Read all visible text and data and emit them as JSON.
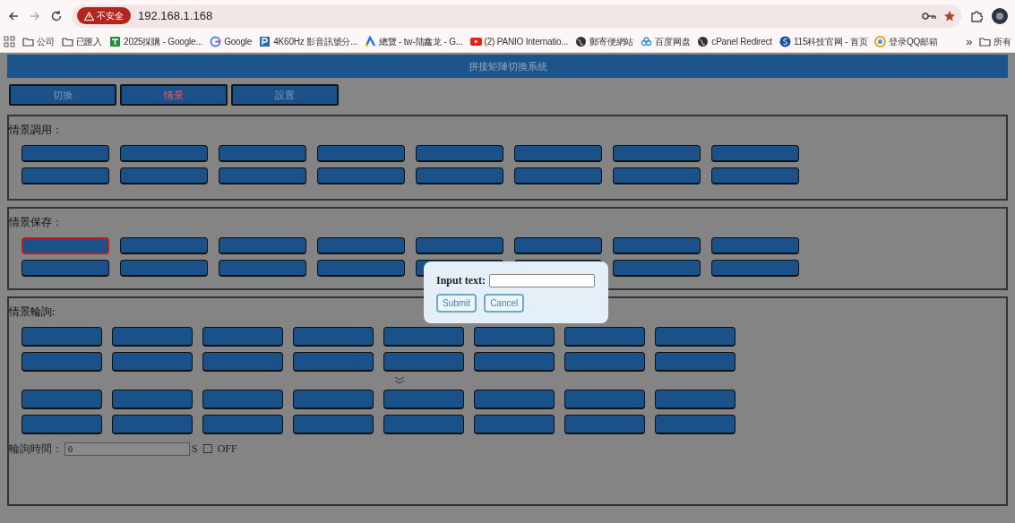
{
  "browser": {
    "security_label": "不安全",
    "url": "192.168.1.168",
    "bookmarks": [
      {
        "kind": "apps"
      },
      {
        "kind": "folder",
        "label": "公司"
      },
      {
        "kind": "folder",
        "label": "已匯入"
      },
      {
        "kind": "sheet",
        "label": "2025採購 - Google..."
      },
      {
        "kind": "google",
        "label": "Google"
      },
      {
        "kind": "p",
        "label": "4K60Hz 影音訊號分..."
      },
      {
        "kind": "ads",
        "label": "總覽 - tw-陆鑫龙 - G..."
      },
      {
        "kind": "video",
        "label": "(2) PANIO Internatio..."
      },
      {
        "kind": "globe",
        "label": "郵寄便網站"
      },
      {
        "kind": "cloud",
        "label": "百度网盘"
      },
      {
        "kind": "globe",
        "label": "cPanel Redirect"
      },
      {
        "kind": "s",
        "label": "115科技官网 - 首页"
      },
      {
        "kind": "qq",
        "label": "登录QQ邮箱"
      }
    ],
    "more": "»",
    "folder_label": "所有"
  },
  "page": {
    "title": "拼接矩陣切換系統",
    "tabs": [
      {
        "label": "切換",
        "selected": false
      },
      {
        "label": "情景",
        "selected": true
      },
      {
        "label": "設置",
        "selected": false
      }
    ],
    "sections": [
      {
        "label": "情景調用：",
        "groups": [
          {
            "rows": [
              [
                {
                  "selected": false
                },
                {
                  "selected": false
                },
                {
                  "selected": false
                },
                {
                  "selected": false
                },
                {
                  "selected": false
                },
                {
                  "selected": false
                },
                {
                  "selected": false
                },
                {
                  "selected": false
                }
              ],
              [
                {
                  "selected": false
                },
                {
                  "selected": false
                },
                {
                  "selected": false
                },
                {
                  "selected": false
                },
                {
                  "selected": false
                },
                {
                  "selected": false
                },
                {
                  "selected": false
                },
                {
                  "selected": false
                }
              ]
            ]
          }
        ]
      },
      {
        "label": "情景保存：",
        "groups": [
          {
            "rows": [
              [
                {
                  "selected": true
                },
                {
                  "selected": false
                },
                {
                  "selected": false
                },
                {
                  "selected": false
                },
                {
                  "selected": false
                },
                {
                  "selected": false
                },
                {
                  "selected": false
                },
                {
                  "selected": false
                }
              ],
              [
                {
                  "selected": false
                },
                {
                  "selected": false
                },
                {
                  "selected": false
                },
                {
                  "selected": false
                },
                {
                  "selected": false
                },
                {
                  "selected": false
                },
                {
                  "selected": false
                },
                {
                  "selected": false
                }
              ]
            ]
          }
        ]
      },
      {
        "label": "情景輪詢:",
        "groups": [
          {
            "rows": [
              [
                {
                  "selected": false
                },
                {
                  "selected": false
                },
                {
                  "selected": false
                },
                {
                  "selected": false
                },
                {
                  "selected": false
                },
                {
                  "selected": false
                },
                {
                  "selected": false
                },
                {
                  "selected": false
                }
              ],
              [
                {
                  "selected": false
                },
                {
                  "selected": false
                },
                {
                  "selected": false
                },
                {
                  "selected": false
                },
                {
                  "selected": false
                },
                {
                  "selected": false
                },
                {
                  "selected": false
                },
                {
                  "selected": false
                }
              ]
            ]
          },
          {
            "rows": [
              [
                {
                  "selected": false
                },
                {
                  "selected": false
                },
                {
                  "selected": false
                },
                {
                  "selected": false
                },
                {
                  "selected": false
                },
                {
                  "selected": false
                },
                {
                  "selected": false
                },
                {
                  "selected": false
                }
              ],
              [
                {
                  "selected": false
                },
                {
                  "selected": false
                },
                {
                  "selected": false
                },
                {
                  "selected": false
                },
                {
                  "selected": false
                },
                {
                  "selected": false
                },
                {
                  "selected": false
                },
                {
                  "selected": false
                }
              ]
            ]
          }
        ],
        "poll": {
          "label": "輪詢時間：",
          "value": "0",
          "unit": "S",
          "checked": false,
          "check_label": "OFF"
        }
      }
    ]
  },
  "dialog": {
    "label": "Input text:",
    "buttons": [
      "Submit",
      "Cancel"
    ]
  }
}
